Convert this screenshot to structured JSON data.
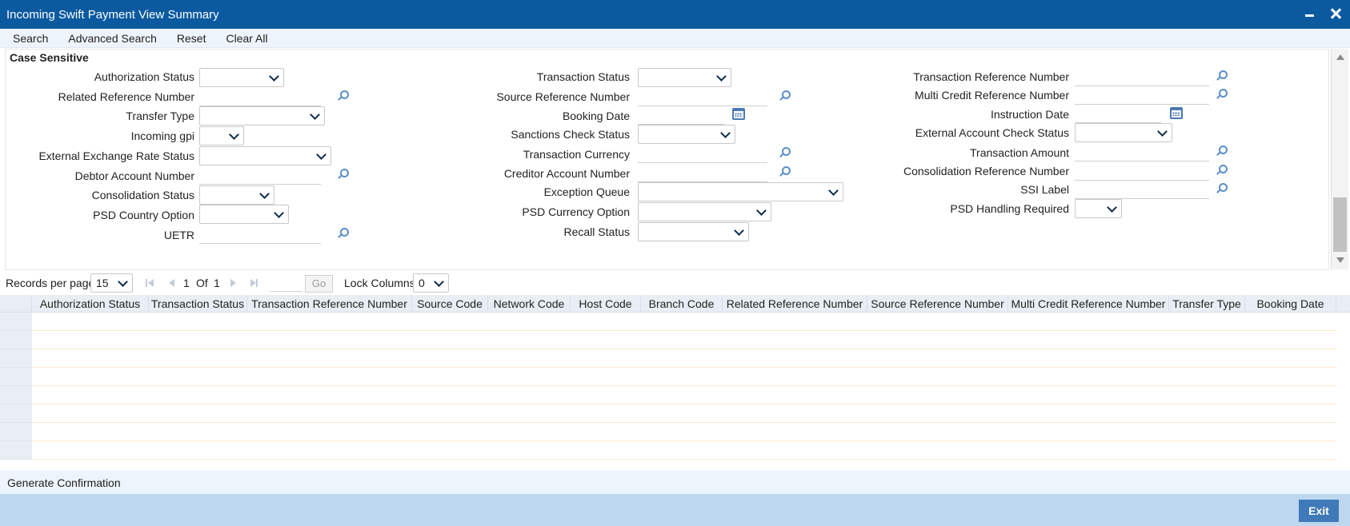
{
  "window": {
    "title": "Incoming Swift Payment View Summary"
  },
  "toolbar": {
    "items": [
      "Search",
      "Advanced Search",
      "Reset",
      "Clear All"
    ]
  },
  "panel": {
    "title": "Case Sensitive"
  },
  "fields": {
    "authorization_status": {
      "label": "Authorization Status",
      "value": ""
    },
    "related_reference_number": {
      "label": "Related Reference Number",
      "value": ""
    },
    "transfer_type": {
      "label": "Transfer Type",
      "value": ""
    },
    "incoming_gpi": {
      "label": "Incoming gpi",
      "value": ""
    },
    "external_exchange_rate_status": {
      "label": "External Exchange Rate Status",
      "value": ""
    },
    "debtor_account_number": {
      "label": "Debtor Account Number",
      "value": ""
    },
    "consolidation_status": {
      "label": "Consolidation Status",
      "value": ""
    },
    "psd_country_option": {
      "label": "PSD Country Option",
      "value": ""
    },
    "uetr": {
      "label": "UETR",
      "value": ""
    },
    "transaction_status": {
      "label": "Transaction Status",
      "value": ""
    },
    "source_reference_number": {
      "label": "Source Reference Number",
      "value": ""
    },
    "booking_date": {
      "label": "Booking Date",
      "value": ""
    },
    "sanctions_check_status": {
      "label": "Sanctions Check Status",
      "value": ""
    },
    "transaction_currency": {
      "label": "Transaction Currency",
      "value": ""
    },
    "creditor_account_number": {
      "label": "Creditor Account Number",
      "value": ""
    },
    "exception_queue": {
      "label": "Exception Queue",
      "value": ""
    },
    "psd_currency_option": {
      "label": "PSD Currency Option",
      "value": ""
    },
    "recall_status": {
      "label": "Recall Status",
      "value": ""
    },
    "transaction_reference_number": {
      "label": "Transaction Reference Number",
      "value": ""
    },
    "multi_credit_reference_number": {
      "label": "Multi Credit Reference Number",
      "value": ""
    },
    "instruction_date": {
      "label": "Instruction Date",
      "value": ""
    },
    "external_account_check_status": {
      "label": "External Account Check Status",
      "value": ""
    },
    "transaction_amount": {
      "label": "Transaction Amount",
      "value": ""
    },
    "consolidation_reference_number": {
      "label": "Consolidation Reference Number",
      "value": ""
    },
    "ssi_label": {
      "label": "SSI Label",
      "value": ""
    },
    "psd_handling_required": {
      "label": "PSD Handling Required",
      "value": ""
    }
  },
  "pager": {
    "records_per_page_label": "Records per page",
    "records_per_page": "15",
    "current_page": "1",
    "of_label": "Of",
    "total_pages": "1",
    "go_label": "Go",
    "lock_columns_label": "Lock Columns",
    "lock_columns": "0"
  },
  "grid": {
    "columns": [
      "Authorization Status",
      "Transaction Status",
      "Transaction Reference Number",
      "Source Code",
      "Network Code",
      "Host Code",
      "Branch Code",
      "Related Reference Number",
      "Source Reference Number",
      "Multi Credit Reference Number",
      "Transfer Type",
      "Booking Date"
    ]
  },
  "footer": {
    "generate_confirmation": "Generate Confirmation",
    "exit_label": "Exit"
  },
  "colors": {
    "titlebar": "#0b5aa0",
    "bottom_bar": "#bcd7ee",
    "exit_button": "#3f79b7",
    "grid_header": "#e9eef4"
  }
}
